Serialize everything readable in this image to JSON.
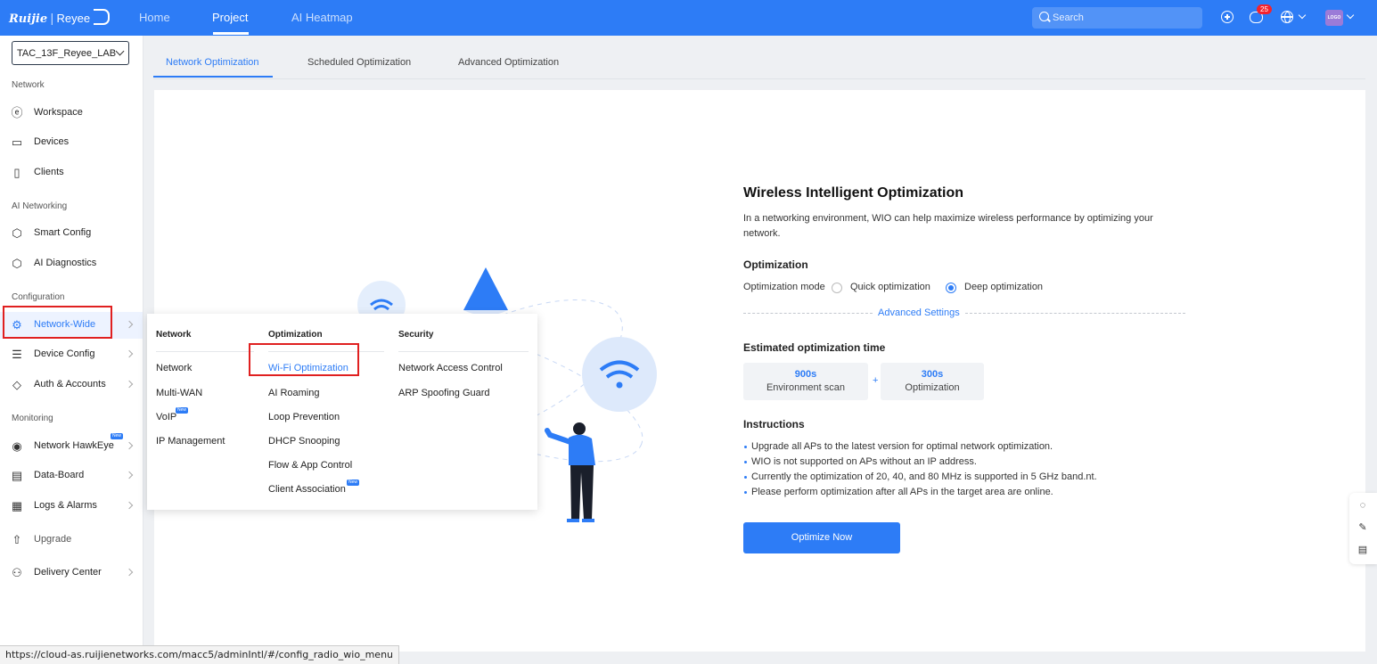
{
  "brand": {
    "ruijie": "Ruijie",
    "reyee": "Reyee"
  },
  "topnav": {
    "items": [
      "Home",
      "Project",
      "AI Heatmap"
    ],
    "active": "Project"
  },
  "search": {
    "placeholder": "Search"
  },
  "notifications": {
    "count": "25"
  },
  "avatar": {
    "text": "LOGO"
  },
  "colors": {
    "primary": "#2d7cf6",
    "highlight": "#e02020"
  },
  "sidebar": {
    "project": "TAC_13F_Reyee_LAB",
    "sections": {
      "network": "Network",
      "ai": "AI Networking",
      "config": "Configuration",
      "monitoring": "Monitoring"
    },
    "items": [
      {
        "label": "Workspace",
        "icon": "workspace-icon"
      },
      {
        "label": "Devices",
        "icon": "devices-icon"
      },
      {
        "label": "Clients",
        "icon": "clients-icon"
      },
      {
        "label": "Smart Config",
        "icon": "smart-config-icon"
      },
      {
        "label": "AI Diagnostics",
        "icon": "ai-diagnostics-icon"
      },
      {
        "label": "Network-Wide",
        "icon": "gear-icon"
      },
      {
        "label": "Device Config",
        "icon": "sliders-icon"
      },
      {
        "label": "Auth & Accounts",
        "icon": "shield-icon"
      },
      {
        "label": "Network HawkEye",
        "icon": "eye-icon"
      },
      {
        "label": "Data-Board",
        "icon": "dashboard-icon"
      },
      {
        "label": "Logs & Alarms",
        "icon": "logs-icon"
      },
      {
        "label": "Upgrade",
        "icon": "upgrade-icon"
      },
      {
        "label": "Delivery Center",
        "icon": "delivery-icon"
      }
    ]
  },
  "tabs": [
    "Network Optimization",
    "Scheduled Optimization",
    "Advanced Optimization"
  ],
  "popup": {
    "columns": [
      {
        "title": "Network",
        "items": [
          "Network",
          "Multi-WAN",
          "VoIP",
          "IP Management"
        ]
      },
      {
        "title": "Optimization",
        "items": [
          "Wi-Fi Optimization",
          "AI Roaming",
          "Loop Prevention",
          "DHCP Snooping",
          "Flow & App Control",
          "Client Association"
        ]
      },
      {
        "title": "Security",
        "items": [
          "Network Access Control",
          "ARP Spoofing Guard"
        ]
      }
    ],
    "new_tag": "New"
  },
  "wio": {
    "title": "Wireless Intelligent Optimization",
    "desc_line1": "In a networking environment, WIO can help maximize wireless performance by optimizing your",
    "desc_line2": "network.",
    "optimization_title": "Optimization",
    "mode_label": "Optimization mode",
    "quick": "Quick optimization",
    "deep": "Deep optimization",
    "selected_mode": "Deep optimization",
    "advanced": "Advanced Settings",
    "est_title": "Estimated optimization time",
    "scan_value": "900s",
    "scan_label": "Environment scan",
    "plus": "+",
    "opt_value": "300s",
    "opt_label": "Optimization",
    "instructions_title": "Instructions",
    "instructions": [
      "Upgrade all APs to the latest version for optimal network optimization.",
      "WIO is not supported on APs without an IP address.",
      "Currently the optimization of 20, 40, and 80 MHz is supported in 5 GHz band.nt.",
      "Please perform optimization after all APs in the target area are online."
    ],
    "button": "Optimize Now"
  },
  "status_url": "https://cloud-as.ruijienetworks.com/macc5/adminIntl/#/config_radio_wio_menu"
}
